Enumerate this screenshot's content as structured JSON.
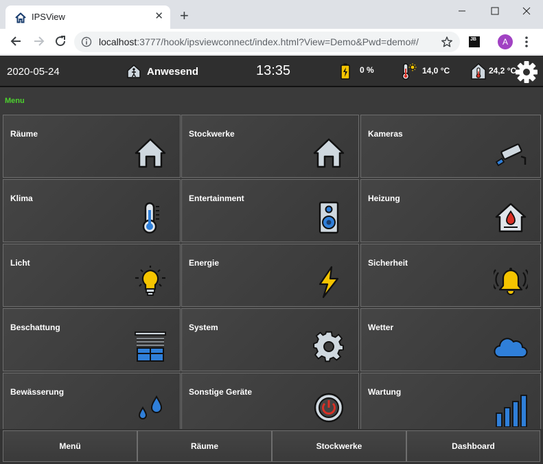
{
  "browser": {
    "tab_title": "IPSView",
    "tab_close": "✕",
    "new_tab": "+",
    "url_host": "localhost",
    "url_rest": ":3777/hook/ipsviewconnect/index.html?View=Demo&Pwd=demo#/",
    "jb_badge": "JB",
    "avatar_letter": "A"
  },
  "statusbar": {
    "date": "2020-05-24",
    "presence": "Anwesend",
    "time": "13:35",
    "battery": "0 %",
    "outdoor_temp": "14,0 °C",
    "indoor_temp": "24,2 °C"
  },
  "menu_label": "Menu",
  "tiles": [
    {
      "label": "Räume",
      "icon": "house-icon"
    },
    {
      "label": "Stockwerke",
      "icon": "house-icon"
    },
    {
      "label": "Kameras",
      "icon": "camera-icon"
    },
    {
      "label": "Klima",
      "icon": "thermometer-icon"
    },
    {
      "label": "Entertainment",
      "icon": "speaker-icon"
    },
    {
      "label": "Heizung",
      "icon": "heating-house-icon"
    },
    {
      "label": "Licht",
      "icon": "lightbulb-icon"
    },
    {
      "label": "Energie",
      "icon": "lightning-icon"
    },
    {
      "label": "Sicherheit",
      "icon": "alarm-bell-icon"
    },
    {
      "label": "Beschattung",
      "icon": "window-shade-icon"
    },
    {
      "label": "System",
      "icon": "gear-icon"
    },
    {
      "label": "Wetter",
      "icon": "cloud-icon"
    },
    {
      "label": "Bewässerung",
      "icon": "water-drops-icon"
    },
    {
      "label": "Sonstige Geräte",
      "icon": "power-button-icon"
    },
    {
      "label": "Wartung",
      "icon": "signal-bars-icon"
    }
  ],
  "bottom_nav": [
    {
      "label": "Menü"
    },
    {
      "label": "Räume"
    },
    {
      "label": "Stockwerke"
    },
    {
      "label": "Dashboard"
    }
  ],
  "colors": {
    "accent_green": "#4cd12e",
    "tile_bg": "#424242",
    "tile_border": "#6e6e6e",
    "icon_blue": "#2f7fd9",
    "icon_yellow": "#f5c400"
  }
}
